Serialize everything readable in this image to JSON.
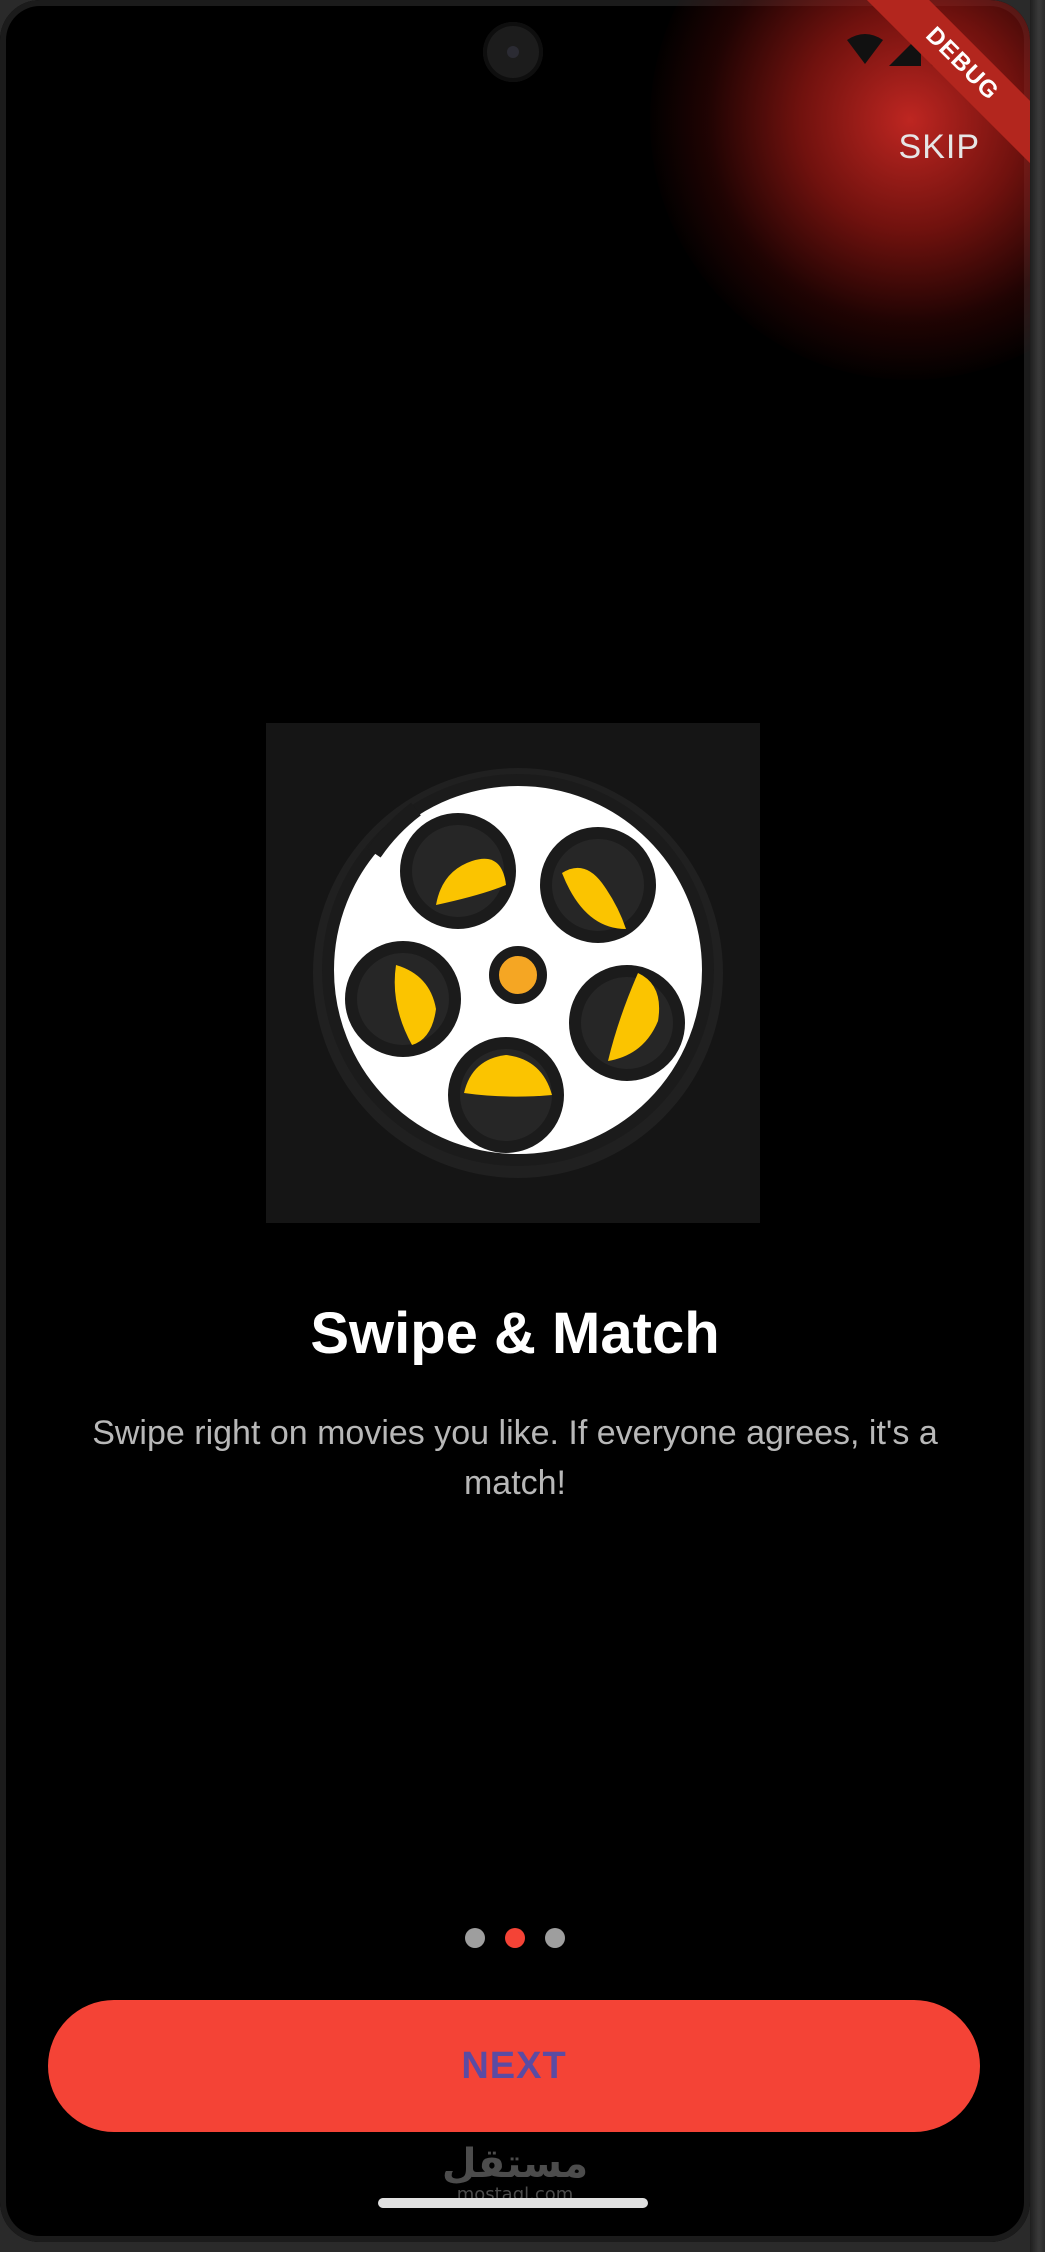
{
  "status_bar": {
    "debug_label": "DEBUG",
    "icons": [
      "wifi-icon",
      "signal-icon",
      "battery-icon"
    ]
  },
  "header": {
    "skip_label": "SKIP"
  },
  "onboarding": {
    "illustration": "film-reel-icon",
    "title": "Swipe & Match",
    "description": "Swipe right on movies you like. If everyone agrees, it's a match!",
    "page_count": 3,
    "current_page": 2
  },
  "footer": {
    "next_label": "NEXT"
  },
  "watermark": {
    "main": "مستقل",
    "sub": "mostaql.com"
  },
  "colors": {
    "background": "#000000",
    "accent": "#f44336",
    "button_text": "#5b4ba3",
    "dot_inactive": "#9e9e9e",
    "reel_yellow": "#fbc400",
    "reel_center": "#f5a623"
  }
}
